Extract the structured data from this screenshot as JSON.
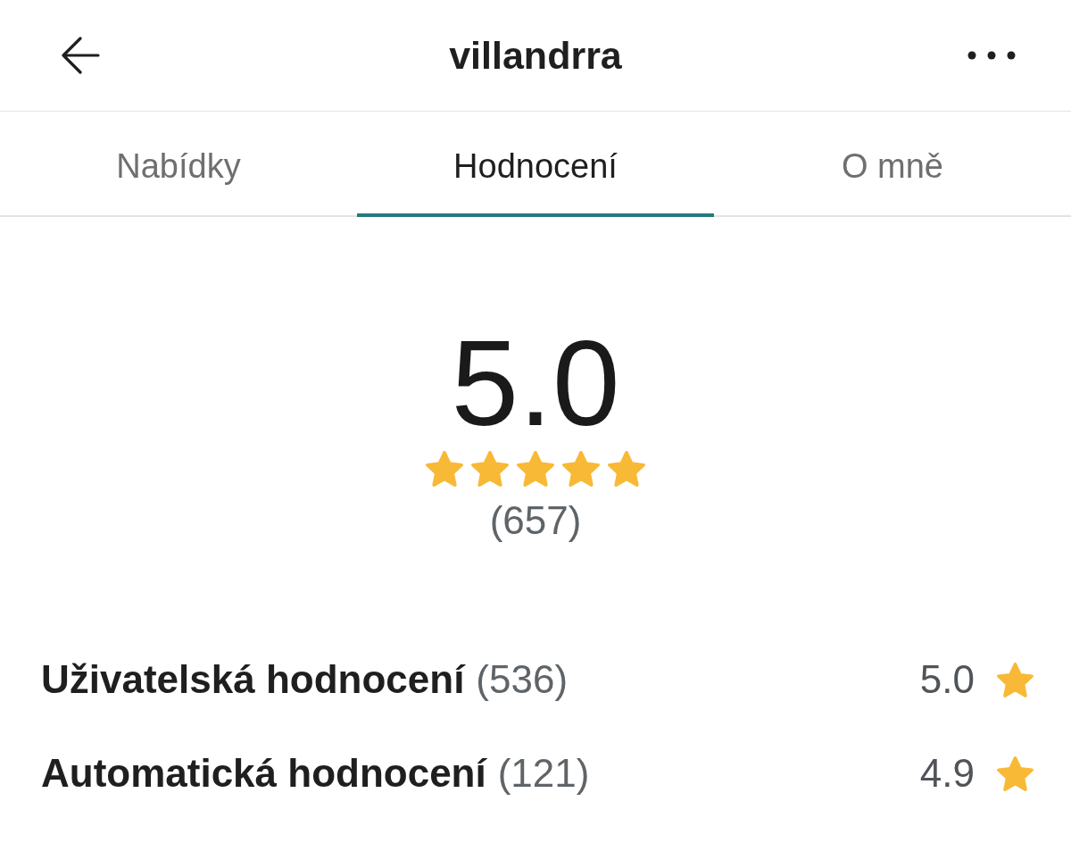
{
  "header": {
    "title": "villandrra"
  },
  "tabs": [
    {
      "label": "Nabídky",
      "selected": false
    },
    {
      "label": "Hodnocení",
      "selected": true
    },
    {
      "label": "O mně",
      "selected": false
    }
  ],
  "rating": {
    "score": "5.0",
    "stars": 5,
    "count": "(657)"
  },
  "breakdown": [
    {
      "label": "Uživatelská hodnocení",
      "count": "(536)",
      "score": "5.0"
    },
    {
      "label": "Automatická hodnocení",
      "count": "(121)",
      "score": "4.9"
    }
  ]
}
